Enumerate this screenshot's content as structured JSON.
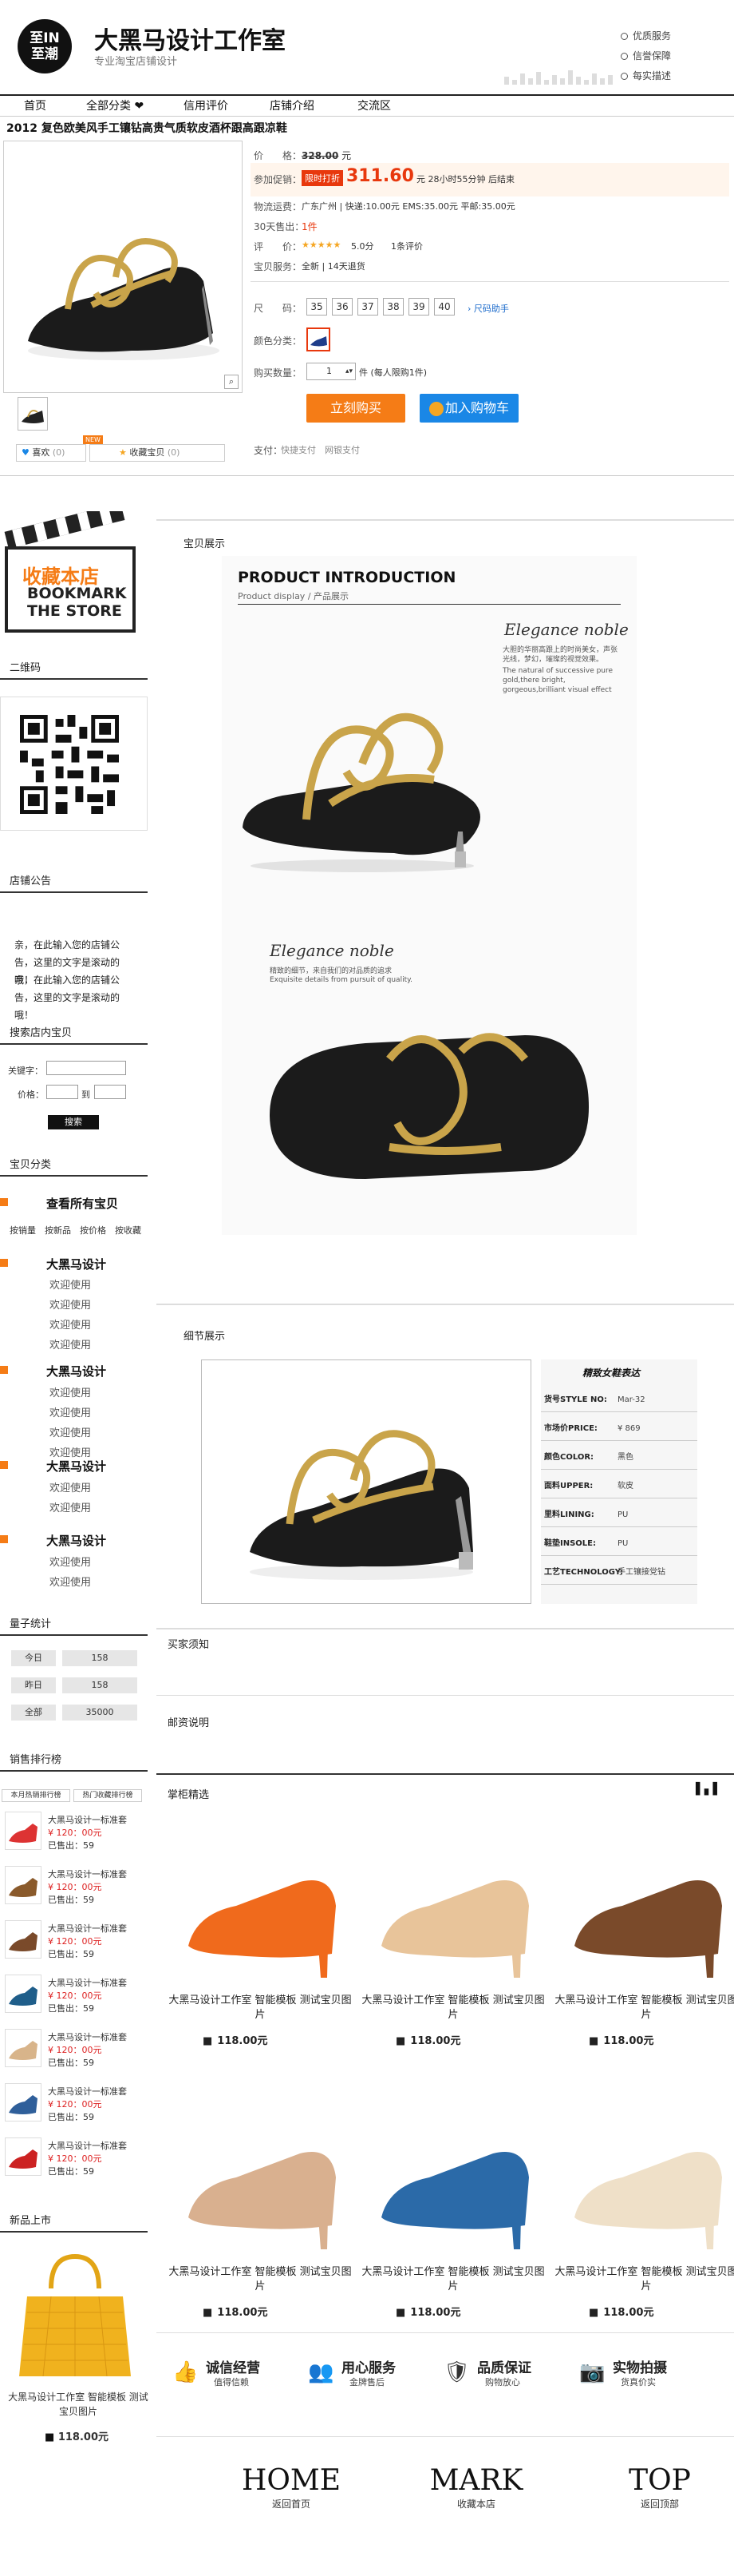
{
  "header": {
    "logo_top": "至IN",
    "logo_bottom": "至潮",
    "store_name": "大黑马设计工作室",
    "store_sub": "专业淘宝店铺设计",
    "services": [
      "优质服务",
      "信誉保障",
      "每实描述"
    ]
  },
  "nav": [
    "首页",
    "全部分类 ❤",
    "信用评价",
    "店铺介绍",
    "交流区"
  ],
  "product": {
    "title": "2012 复色欧美风手工镶钻高贵气质软皮酒杯跟高跟凉鞋",
    "price_label": "价　　格：",
    "price": "328.00",
    "price_unit": "元",
    "promo_label": "参加促销：",
    "promo_tag": "限时打折",
    "promo_price": "311.60",
    "promo_note": "元 28小时55分钟 后结束",
    "ship_label": "物流运费：",
    "ship_value": "广东广州 | 快递:10.00元 EMS:35.00元 平邮:35.00元",
    "sold_label": "30天售出：",
    "sold_value": "1件",
    "rating_label": "评　　价：",
    "rating_value": "5.0分",
    "rating_count": "1条评价",
    "service_label": "宝贝服务：",
    "service_value": "全新 | 14天退货",
    "size_label": "尺　　码：",
    "sizes": [
      "35",
      "36",
      "37",
      "38",
      "39",
      "40"
    ],
    "size_help": "尺码助手",
    "color_label": "颜色分类：",
    "qty_label": "购买数量：",
    "qty_value": "1",
    "qty_unit": "件 (每人限购1件)",
    "buy_label": "立刻购买",
    "cart_label": "加入购物车",
    "pay_label": "支付：",
    "pay_value": "快捷支付　网银支付",
    "like_label": "喜欢",
    "like_count": "(0)",
    "fav_label": "收藏宝贝",
    "fav_count": "(0)",
    "new_badge": "NEW"
  },
  "sidebar": {
    "bookmark_cn": "收藏本店",
    "bookmark_en1": "BOOKMARK",
    "bookmark_en2": "THE STORE",
    "qr_title": "二维码",
    "notice_title": "店铺公告",
    "notice_text": [
      "亲，在此输入您的店铺公告，这里的文字是滚动的哦！",
      "亲，在此输入您的店铺公告，这里的文字是滚动的哦！"
    ],
    "search_title": "搜索店内宝贝",
    "keyword_label": "关键字：",
    "price_label": "价格：",
    "price_to": "到",
    "search_btn": "搜索",
    "cat_title": "宝贝分类",
    "cat_all": "查看所有宝贝",
    "sort": [
      "按销量",
      "按新品",
      "按价格",
      "按收藏"
    ],
    "groups": [
      {
        "name": "大黑马设计",
        "items": [
          "欢迎使用",
          "欢迎使用",
          "欢迎使用",
          "欢迎使用"
        ]
      },
      {
        "name": "大黑马设计",
        "items": [
          "欢迎使用",
          "欢迎使用",
          "欢迎使用",
          "欢迎使用"
        ]
      },
      {
        "name": "大黑马设计",
        "items": [
          "欢迎使用",
          "欢迎使用"
        ]
      },
      {
        "name": "大黑马设计",
        "items": [
          "欢迎使用",
          "欢迎使用"
        ]
      }
    ],
    "stats_title": "量子统计",
    "stats": [
      {
        "label": "今日",
        "value": "158"
      },
      {
        "label": "昨日",
        "value": "158"
      },
      {
        "label": "全部",
        "value": "35000"
      }
    ],
    "rank_title": "销售排行榜",
    "rank_tabs": [
      "本月热销排行榜",
      "热门收藏排行榜"
    ],
    "rank_items": [
      {
        "name": "大黑马设计一标准套",
        "price": "¥ 120：00元",
        "sold": "已售出：59"
      },
      {
        "name": "大黑马设计一标准套",
        "price": "¥ 120：00元",
        "sold": "已售出：59"
      },
      {
        "name": "大黑马设计一标准套",
        "price": "¥ 120：00元",
        "sold": "已售出：59"
      },
      {
        "name": "大黑马设计一标准套",
        "price": "¥ 120：00元",
        "sold": "已售出：59"
      },
      {
        "name": "大黑马设计一标准套",
        "price": "¥ 120：00元",
        "sold": "已售出：59"
      },
      {
        "name": "大黑马设计一标准套",
        "price": "¥ 120：00元",
        "sold": "已售出：59"
      },
      {
        "name": "大黑马设计一标准套",
        "price": "¥ 120：00元",
        "sold": "已售出：59"
      }
    ],
    "new_title": "新品上市",
    "new_caption": "大黑马设计工作室 智能模板 测试宝贝图片",
    "new_price": "118.00元"
  },
  "main": {
    "intro_title": "宝贝展示",
    "intro_en": "PRODUCT INTRODUCTION",
    "intro_sub": "Product display /",
    "intro_sub_cn": "产品展示",
    "elegance": "Elegance noble",
    "elegance_desc": "大胆的华丽高跟上的时尚美女，声张光线，梦幻，璀璨的视觉效果。",
    "elegance_en": "The natural of successive pure gold,there bright, gorgeous,brilliant visual effect",
    "elegance2_desc": "精致的细节，来自我们的对品质的追求",
    "elegance2_en": "Exquisite details from pursuit of quality.",
    "detail_title": "细节展示",
    "detail_header": "精致女鞋表达",
    "detail_rows": [
      {
        "k": "货号STYLE NO:",
        "v": "Mar-32"
      },
      {
        "k": "市场价PRICE:",
        "v": "¥ 869"
      },
      {
        "k": "颜色COLOR:",
        "v": "黑色"
      },
      {
        "k": "面料UPPER:",
        "v": "软皮"
      },
      {
        "k": "里料LINING:",
        "v": "PU"
      },
      {
        "k": "鞋垫INSOLE:",
        "v": "PU"
      },
      {
        "k": "工艺TECHNOLOGY:",
        "v": "手工镶接党钻"
      }
    ],
    "notice_title": "买家须知",
    "post_title": "邮资说明",
    "shelf_title": "掌柜精选",
    "shelf": [
      {
        "caption": "大黑马设计工作室 智能模板 测试宝贝图片",
        "price": "118.00元"
      },
      {
        "caption": "大黑马设计工作室 智能模板 测试宝贝图片",
        "price": "118.00元"
      },
      {
        "caption": "大黑马设计工作室 智能模板 测试宝贝图片",
        "price": "118.00元"
      },
      {
        "caption": "大黑马设计工作室 智能模板 测试宝贝图片",
        "price": "118.00元"
      },
      {
        "caption": "大黑马设计工作室 智能模板 测试宝贝图片",
        "price": "118.00元"
      },
      {
        "caption": "大黑马设计工作室 智能模板 测试宝贝图片",
        "price": "118.00元"
      }
    ],
    "promises": [
      {
        "t": "诚信经营",
        "s": "值得信赖"
      },
      {
        "t": "用心服务",
        "s": "金牌售后"
      },
      {
        "t": "品质保证",
        "s": "购物放心"
      },
      {
        "t": "实物拍摄",
        "s": "货真价实"
      }
    ],
    "footer": [
      {
        "t": "HOME",
        "s": "返回首页"
      },
      {
        "t": "MARK",
        "s": "收藏本店"
      },
      {
        "t": "TOP",
        "s": "返回顶部"
      }
    ]
  },
  "colors": {
    "orange": "#f57c16",
    "blue": "#1a87e6",
    "promo": "#e8380d"
  }
}
